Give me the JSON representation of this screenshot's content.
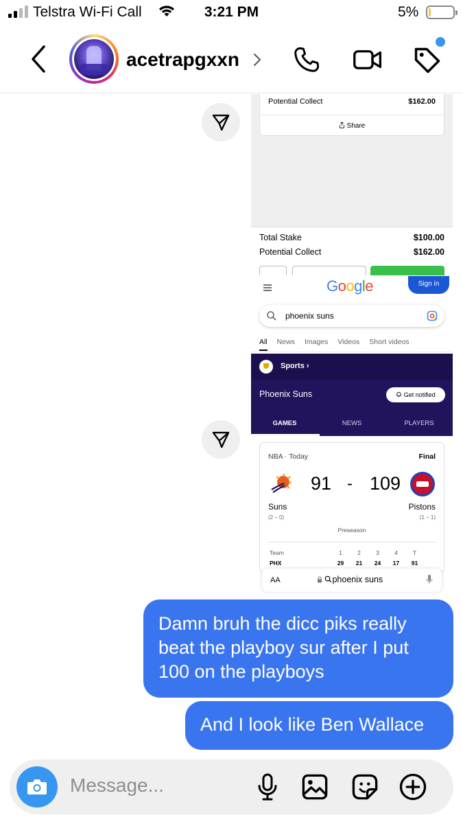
{
  "status_bar": {
    "carrier": "Telstra Wi-Fi Call",
    "time": "3:21 PM",
    "battery_percent": "5%",
    "battery_level": 0.05
  },
  "header": {
    "username": "acetrapgxxn"
  },
  "shared_screenshot": {
    "bet_card": {
      "potential_label": "Potential Collect",
      "potential_value": "$162.00",
      "share_label": "Share"
    },
    "bet_summary": {
      "stake_label": "Total Stake",
      "stake_value": "$100.00",
      "collect_label": "Potential Collect",
      "collect_value": "$162.00"
    },
    "google": {
      "logo": "Google",
      "sign_in": "Sign in",
      "query": "phoenix suns",
      "tabs": [
        "All",
        "News",
        "Images",
        "Videos",
        "Short videos"
      ],
      "sports_label": "Sports",
      "team_title": "Phoenix Suns",
      "notify_label": "Get notified",
      "sub_tabs": [
        "GAMES",
        "NEWS",
        "PLAYERS"
      ]
    },
    "score": {
      "league": "NBA · Today",
      "status": "Final",
      "home_team": "Suns",
      "home_record": "(2 – 0)",
      "home_score": "91",
      "away_team": "Pistons",
      "away_record": "(1 – 1)",
      "away_score": "109",
      "dash": "-",
      "season_type": "Preseason",
      "box_header": [
        "Team",
        "1",
        "2",
        "3",
        "4",
        "T"
      ],
      "box_row": [
        "PHX",
        "29",
        "21",
        "24",
        "17",
        "91"
      ]
    },
    "safari": {
      "aa": "AA",
      "url": "phoenix suns"
    }
  },
  "messages": [
    {
      "text": "Damn bruh the dicc piks really beat the playboy sur after I put 100 on the playboys"
    },
    {
      "text": "And I look like Ben Wallace"
    }
  ],
  "composer": {
    "placeholder": "Message..."
  },
  "colors": {
    "bubble": "#3a75f0",
    "accent": "#3797f0",
    "sports_band": "#21145c"
  }
}
